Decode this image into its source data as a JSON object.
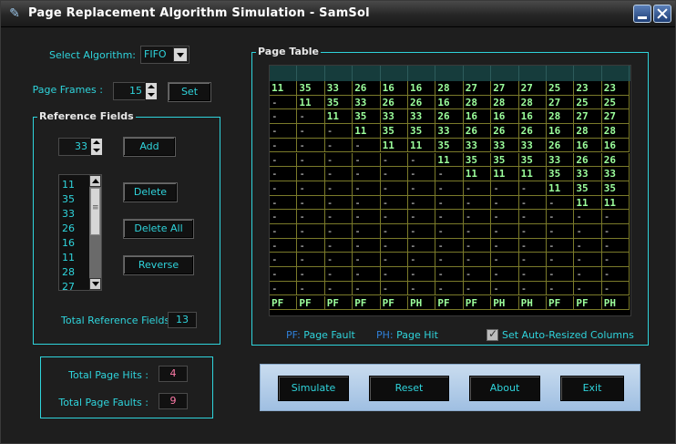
{
  "window": {
    "title": "Page Replacement Algorithm Simulation - SamSol"
  },
  "controls": {
    "select_algorithm_label": "Select Algorithm:",
    "algorithm_value": "FIFO",
    "page_frames_label": "Page Frames :",
    "page_frames_value": "15",
    "set_label": "Set"
  },
  "reference_fields": {
    "title": "Reference Fields",
    "input_value": "33",
    "add_label": "Add",
    "delete_label": "Delete",
    "delete_all_label": "Delete All",
    "reverse_label": "Reverse",
    "list_items": [
      "11",
      "35",
      "33",
      "26",
      "16",
      "11",
      "28",
      "27"
    ],
    "total_label": "Total Reference Fields :",
    "total_value": "13"
  },
  "stats": {
    "hits_label": "Total Page Hits :",
    "hits_value": "4",
    "faults_label": "Total Page Faults :",
    "faults_value": "9"
  },
  "page_table": {
    "title": "Page Table",
    "rows": [
      [
        "11",
        "35",
        "33",
        "26",
        "16",
        "16",
        "28",
        "27",
        "27",
        "27",
        "25",
        "23",
        "23"
      ],
      [
        "-",
        "11",
        "35",
        "33",
        "26",
        "26",
        "16",
        "28",
        "28",
        "28",
        "27",
        "25",
        "25"
      ],
      [
        "-",
        "-",
        "11",
        "35",
        "33",
        "33",
        "26",
        "16",
        "16",
        "16",
        "28",
        "27",
        "27"
      ],
      [
        "-",
        "-",
        "-",
        "11",
        "35",
        "35",
        "33",
        "26",
        "26",
        "26",
        "16",
        "28",
        "28"
      ],
      [
        "-",
        "-",
        "-",
        "-",
        "11",
        "11",
        "35",
        "33",
        "33",
        "33",
        "26",
        "16",
        "16"
      ],
      [
        "-",
        "-",
        "-",
        "-",
        "-",
        "-",
        "11",
        "35",
        "35",
        "35",
        "33",
        "26",
        "26"
      ],
      [
        "-",
        "-",
        "-",
        "-",
        "-",
        "-",
        "-",
        "11",
        "11",
        "11",
        "35",
        "33",
        "33"
      ],
      [
        "-",
        "-",
        "-",
        "-",
        "-",
        "-",
        "-",
        "-",
        "-",
        "-",
        "11",
        "35",
        "35"
      ],
      [
        "-",
        "-",
        "-",
        "-",
        "-",
        "-",
        "-",
        "-",
        "-",
        "-",
        "-",
        "11",
        "11"
      ],
      [
        "-",
        "-",
        "-",
        "-",
        "-",
        "-",
        "-",
        "-",
        "-",
        "-",
        "-",
        "-",
        "-"
      ],
      [
        "-",
        "-",
        "-",
        "-",
        "-",
        "-",
        "-",
        "-",
        "-",
        "-",
        "-",
        "-",
        "-"
      ],
      [
        "-",
        "-",
        "-",
        "-",
        "-",
        "-",
        "-",
        "-",
        "-",
        "-",
        "-",
        "-",
        "-"
      ],
      [
        "-",
        "-",
        "-",
        "-",
        "-",
        "-",
        "-",
        "-",
        "-",
        "-",
        "-",
        "-",
        "-"
      ],
      [
        "-",
        "-",
        "-",
        "-",
        "-",
        "-",
        "-",
        "-",
        "-",
        "-",
        "-",
        "-",
        "-"
      ],
      [
        "-",
        "-",
        "-",
        "-",
        "-",
        "-",
        "-",
        "-",
        "-",
        "-",
        "-",
        "-",
        "-"
      ],
      [
        "PF",
        "PF",
        "PF",
        "PF",
        "PF",
        "PH",
        "PF",
        "PF",
        "PH",
        "PH",
        "PF",
        "PF",
        "PH"
      ]
    ],
    "legend_pf_key": "PF:",
    "legend_pf_text": " Page Fault",
    "legend_ph_key": "PH:",
    "legend_ph_text": " Page Hit",
    "auto_resize_label": "Set Auto-Resized Columns"
  },
  "actions": {
    "simulate": "Simulate",
    "reset": "Reset",
    "about": "About",
    "exit": "Exit"
  },
  "icons": {
    "app": "app-icon",
    "minimize": "minimize-icon",
    "close": "close-icon",
    "dropdown": "chevron-down-icon"
  },
  "colors": {
    "accent": "#2fd4dc",
    "value_green": "#9cff9c",
    "readout_pink": "#ff7aa8",
    "legend_key_blue": "#2f7fd8"
  }
}
